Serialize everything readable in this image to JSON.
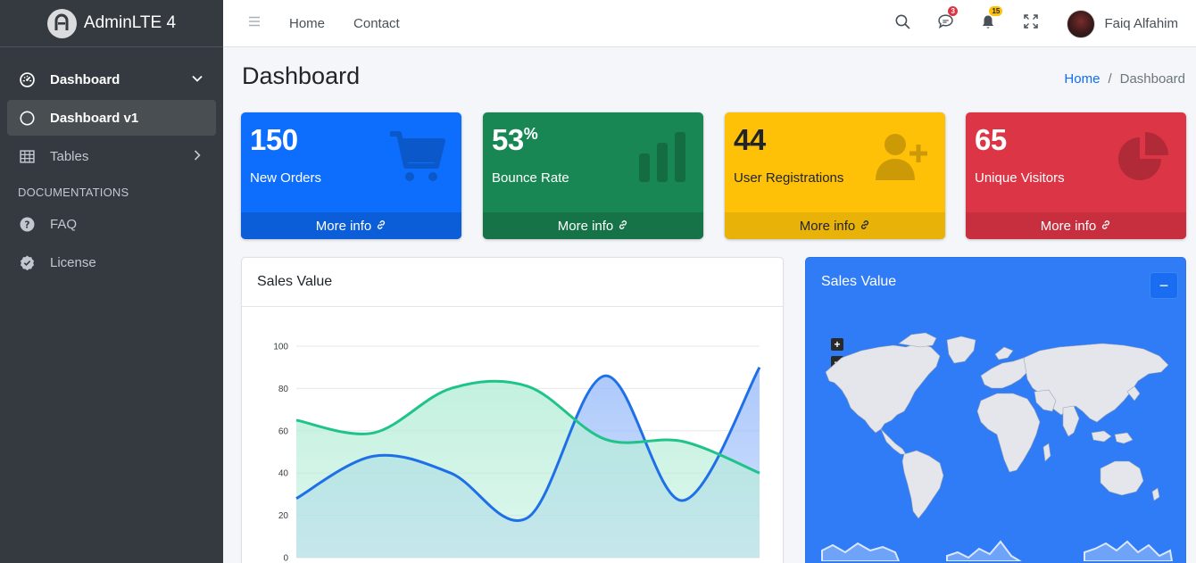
{
  "brand": {
    "name": "AdminLTE 4"
  },
  "sidebar": {
    "items": [
      {
        "label": "Dashboard",
        "icon": "speedometer-icon"
      },
      {
        "label": "Dashboard v1",
        "icon": "circle-icon"
      },
      {
        "label": "Tables",
        "icon": "table-icon"
      }
    ],
    "header": "DOCUMENTATIONS",
    "docs": [
      {
        "label": "FAQ",
        "icon": "question-circle-icon"
      },
      {
        "label": "License",
        "icon": "patch-check-icon"
      }
    ]
  },
  "topbar": {
    "links": [
      "Home",
      "Contact"
    ],
    "messages_count": "3",
    "notifications_count": "15",
    "user_name": "Faiq Alfahim"
  },
  "content": {
    "title": "Dashboard",
    "breadcrumb": {
      "home": "Home",
      "separator": "/",
      "current": "Dashboard"
    }
  },
  "small_boxes": [
    {
      "value": "150",
      "suffix": "",
      "label": "New Orders",
      "more": "More info",
      "icon": "cart-icon",
      "color": "#0d6efd"
    },
    {
      "value": "53",
      "suffix": "%",
      "label": "Bounce Rate",
      "more": "More info",
      "icon": "bar-chart-icon",
      "color": "#198754"
    },
    {
      "value": "44",
      "suffix": "",
      "label": "User Registrations",
      "more": "More info",
      "icon": "person-plus-icon",
      "color": "#ffc107"
    },
    {
      "value": "65",
      "suffix": "",
      "label": "Unique Visitors",
      "more": "More info",
      "icon": "pie-chart-icon",
      "color": "#dc3545"
    }
  ],
  "sales_card": {
    "title": "Sales Value"
  },
  "map_card": {
    "title": "Sales Value",
    "collapse_label": "−",
    "zoom_in": "+",
    "zoom_out": "−"
  },
  "chart_data": {
    "type": "area",
    "title": "Sales Value",
    "x": [
      0,
      1,
      2,
      3,
      4,
      5,
      6
    ],
    "ylim": [
      0,
      100
    ],
    "yticks": [
      0,
      20,
      40,
      60,
      80,
      100
    ],
    "grid": true,
    "series": [
      {
        "values": [
          28,
          48,
          40,
          19,
          86,
          27,
          90
        ],
        "color": "#1f6fe8",
        "fill": "#9dbffa"
      },
      {
        "values": [
          65,
          59,
          80,
          81,
          56,
          55,
          40
        ],
        "color": "#20c38a",
        "fill": "#b8eed9"
      }
    ]
  }
}
